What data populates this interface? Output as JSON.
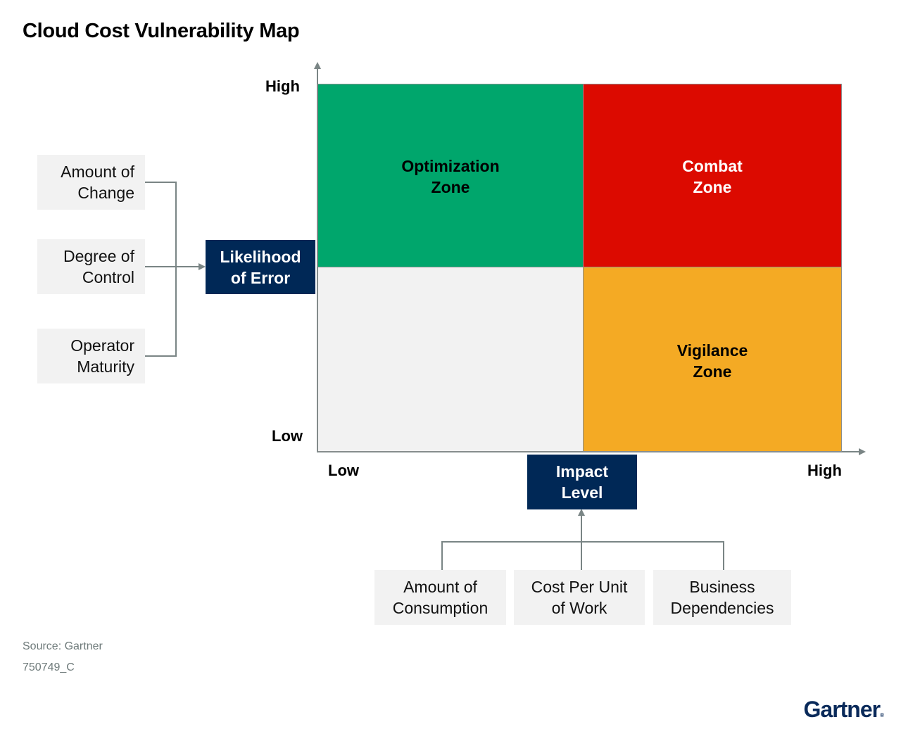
{
  "title": "Cloud Cost Vulnerability Map",
  "y_axis": {
    "name": "Likelihood of Error",
    "name_lines": [
      "Likelihood",
      "of Error"
    ],
    "high_label": "High",
    "low_label": "Low",
    "factors": [
      {
        "lines": [
          "Amount of",
          "Change"
        ]
      },
      {
        "lines": [
          "Degree of",
          "Control"
        ]
      },
      {
        "lines": [
          "Operator",
          "Maturity"
        ]
      }
    ]
  },
  "x_axis": {
    "name": "Impact Level",
    "name_lines": [
      "Impact",
      "Level"
    ],
    "low_label": "Low",
    "high_label": "High",
    "factors": [
      {
        "lines": [
          "Amount of",
          "Consumption"
        ]
      },
      {
        "lines": [
          "Cost Per Unit",
          "of Work"
        ]
      },
      {
        "lines": [
          "Business",
          "Dependencies"
        ]
      }
    ]
  },
  "quadrants": [
    {
      "position": "top-left",
      "lines": [
        "Optimization",
        "Zone"
      ],
      "color": "#00a66c",
      "text_color": "#000000"
    },
    {
      "position": "top-right",
      "lines": [
        "Combat",
        "Zone"
      ],
      "color": "#dc0a00",
      "text_color": "#ffffff"
    },
    {
      "position": "bottom-left",
      "lines": [],
      "color": "#f2f2f2",
      "text_color": "#000000"
    },
    {
      "position": "bottom-right",
      "lines": [
        "Vigilance",
        "Zone"
      ],
      "color": "#f4aa24",
      "text_color": "#000000"
    }
  ],
  "colors": {
    "navy": "#002856",
    "connector": "#7a8585",
    "factor_bg": "#f2f2f2"
  },
  "footer": {
    "source": "Source: Gartner",
    "id": "750749_C"
  },
  "logo": {
    "text": "Gartner",
    "mark": "®"
  }
}
